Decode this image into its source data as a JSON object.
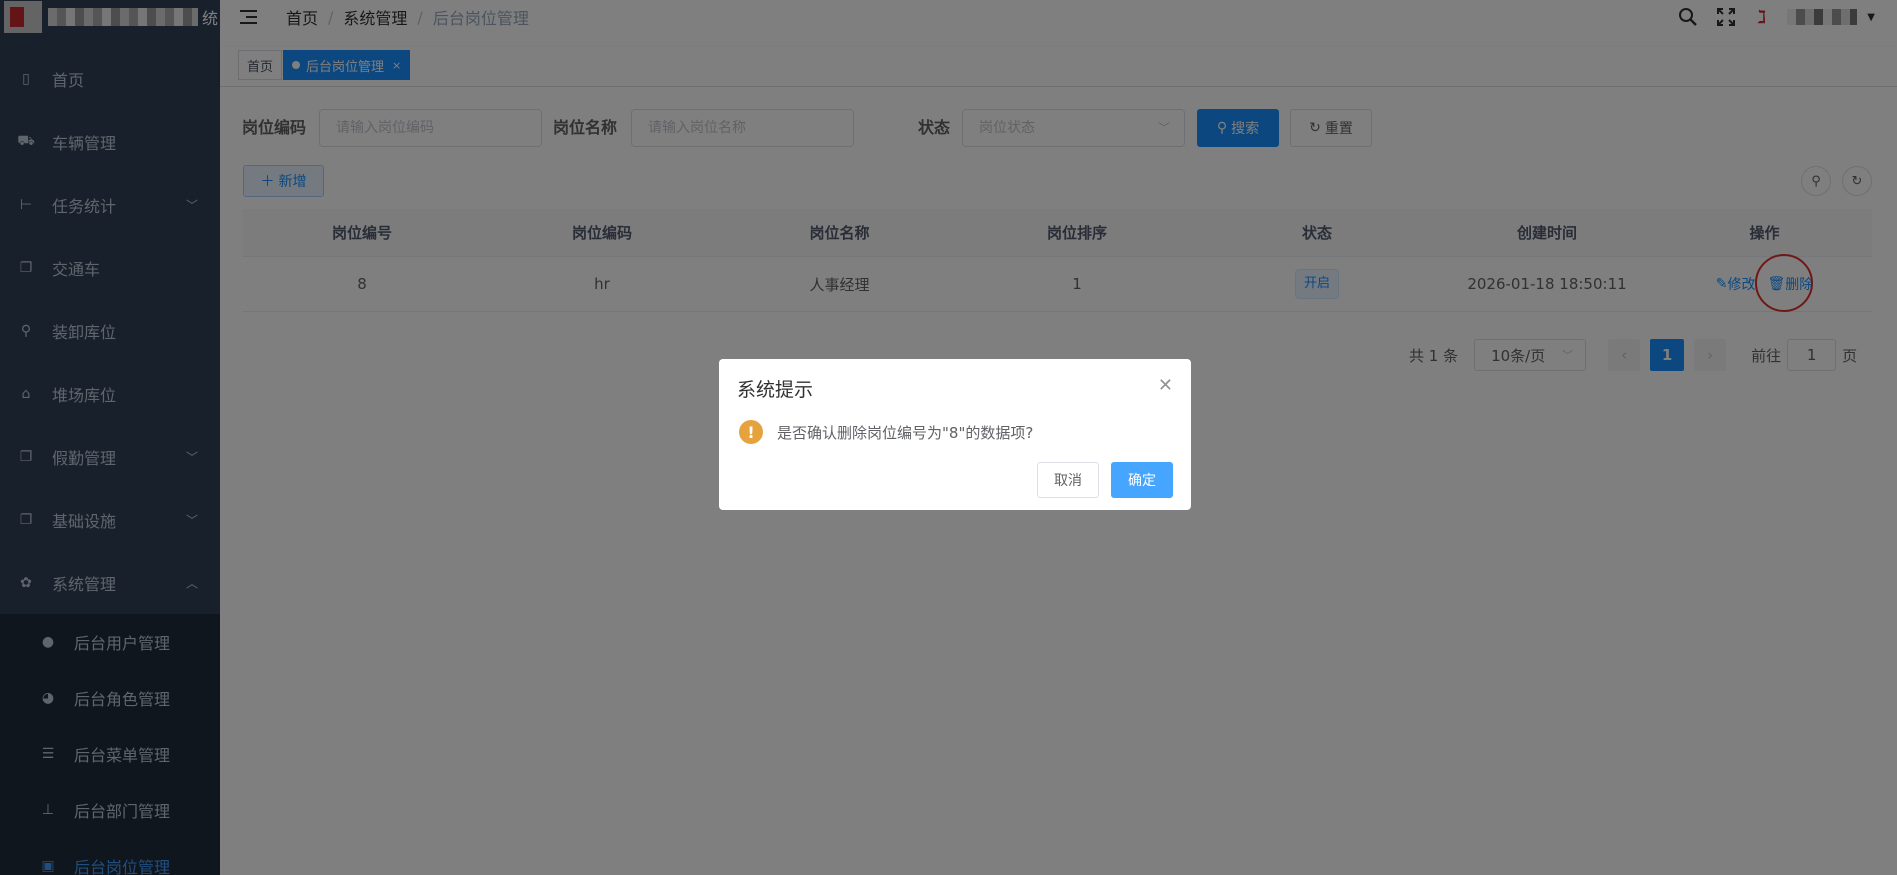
{
  "logo": {
    "suffix": "统"
  },
  "sidebar": {
    "items": [
      {
        "label": "首页",
        "icon": "dashboard-icon"
      },
      {
        "label": "车辆管理",
        "icon": "car-icon"
      },
      {
        "label": "任务统计",
        "icon": "tree-icon",
        "expandable": true
      },
      {
        "label": "交通车",
        "icon": "documents-icon"
      },
      {
        "label": "装卸库位",
        "icon": "loading-icon"
      },
      {
        "label": "堆场库位",
        "icon": "yard-icon"
      },
      {
        "label": "假勤管理",
        "icon": "documents-icon",
        "expandable": true
      },
      {
        "label": "基础设施",
        "icon": "documents-icon",
        "expandable": true
      },
      {
        "label": "系统管理",
        "icon": "gear-icon",
        "expandable": true,
        "expanded": true
      }
    ],
    "subitems": [
      {
        "label": "后台用户管理",
        "icon": "user-icon"
      },
      {
        "label": "后台角色管理",
        "icon": "peoples-icon"
      },
      {
        "label": "后台菜单管理",
        "icon": "list-icon"
      },
      {
        "label": "后台部门管理",
        "icon": "org-tree-icon"
      },
      {
        "label": "后台岗位管理",
        "icon": "post-icon",
        "active": true
      }
    ]
  },
  "breadcrumb": [
    "首页",
    "系统管理",
    "后台岗位管理"
  ],
  "tags": {
    "home": "首页",
    "active": "后台岗位管理",
    "close": "×"
  },
  "search": {
    "code_label": "岗位编码",
    "code_placeholder": "请输入岗位编码",
    "name_label": "岗位名称",
    "name_placeholder": "请输入岗位名称",
    "status_label": "状态",
    "status_placeholder": "岗位状态",
    "search_btn": "搜索",
    "reset_btn": "重置"
  },
  "toolbar": {
    "add_btn": "新增"
  },
  "table": {
    "headers": [
      "岗位编号",
      "岗位编码",
      "岗位名称",
      "岗位排序",
      "状态",
      "创建时间",
      "操作"
    ],
    "rows": [
      {
        "id": "8",
        "code": "hr",
        "name": "人事经理",
        "sort": "1",
        "status": "开启",
        "created": "2026-01-18 18:50:11",
        "edit": "修改",
        "delete": "删除"
      }
    ]
  },
  "pagination": {
    "total": "共 1 条",
    "size": "10条/页",
    "current": "1",
    "goto": "前往",
    "goto_value": "1",
    "page_unit": "页"
  },
  "dialog": {
    "title": "系统提示",
    "message": "是否确认删除岗位编号为\"8\"的数据项?",
    "cancel": "取消",
    "confirm": "确定"
  },
  "colors": {
    "primary": "#1890ff",
    "sidebar_bg": "#304156",
    "warning": "#e6a23c",
    "highlight_ring": "#e03030"
  }
}
